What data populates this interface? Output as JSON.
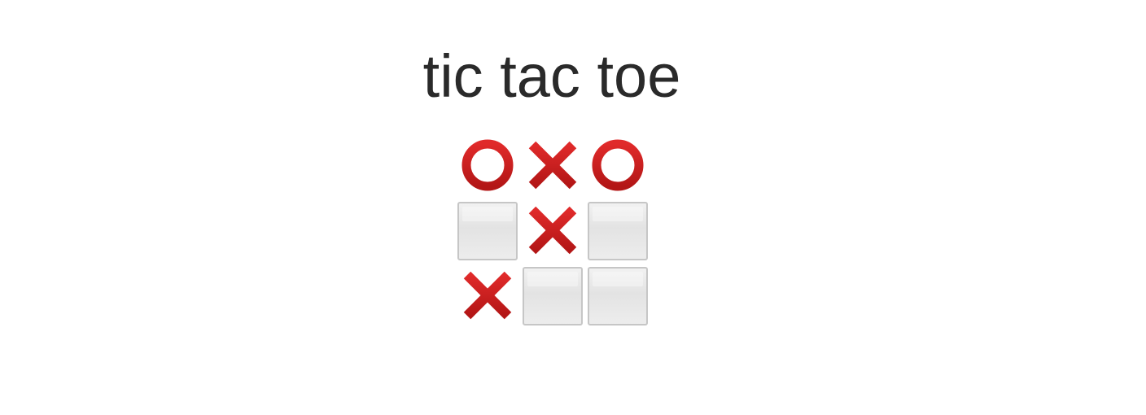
{
  "title": "tic tac toe",
  "board": {
    "cells": [
      "O",
      "X",
      "O",
      "",
      "X",
      "",
      "X",
      "",
      ""
    ]
  },
  "colors": {
    "mark_red": "#e02a2a",
    "mark_red_dark": "#b31616",
    "empty_tile": "#e8e8e8",
    "empty_border": "#c6c6c6",
    "title_text": "#2a2a2a"
  },
  "icons": {
    "X": "cross-mark-icon",
    "O": "circle-mark-icon",
    "": "empty-square-icon"
  }
}
